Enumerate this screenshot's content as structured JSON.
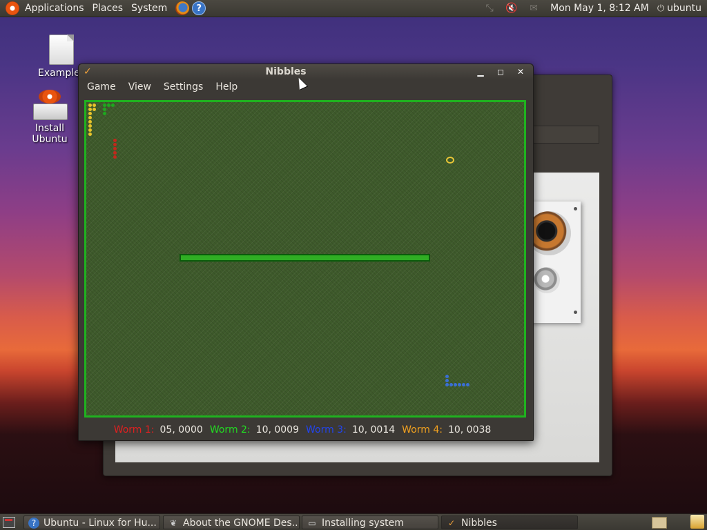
{
  "top_panel": {
    "menus": [
      "Applications",
      "Places",
      "System"
    ],
    "clock": "Mon May  1,  8:12 AM",
    "user": "ubuntu"
  },
  "desktop": {
    "icons": [
      {
        "label": "Examples",
        "icon": "document-icon"
      },
      {
        "label": "Install Ubuntu",
        "icon": "install-icon"
      }
    ]
  },
  "nibbles": {
    "title": "Nibbles",
    "menu": [
      "Game",
      "View",
      "Settings",
      "Help"
    ],
    "scores": [
      {
        "label": "Worm 1:",
        "value": "05, 0000",
        "color": "#e02020"
      },
      {
        "label": "Worm 2:",
        "value": "10, 0009",
        "color": "#22dd22"
      },
      {
        "label": "Worm 3:",
        "value": "10, 0014",
        "color": "#2244ee"
      },
      {
        "label": "Worm 4:",
        "value": "10, 0038",
        "color": "#f0a020"
      }
    ],
    "colors": {
      "board": "#3e5a2b",
      "border": "#1fb21f"
    }
  },
  "taskbar": {
    "tasks": [
      {
        "label": "Ubuntu - Linux for Hu...",
        "icon": "help-icon"
      },
      {
        "label": "About the GNOME Des...",
        "icon": "gnome-foot-icon"
      },
      {
        "label": "Installing system",
        "icon": "installer-icon"
      },
      {
        "label": "Nibbles",
        "icon": "nibbles-icon"
      }
    ]
  }
}
